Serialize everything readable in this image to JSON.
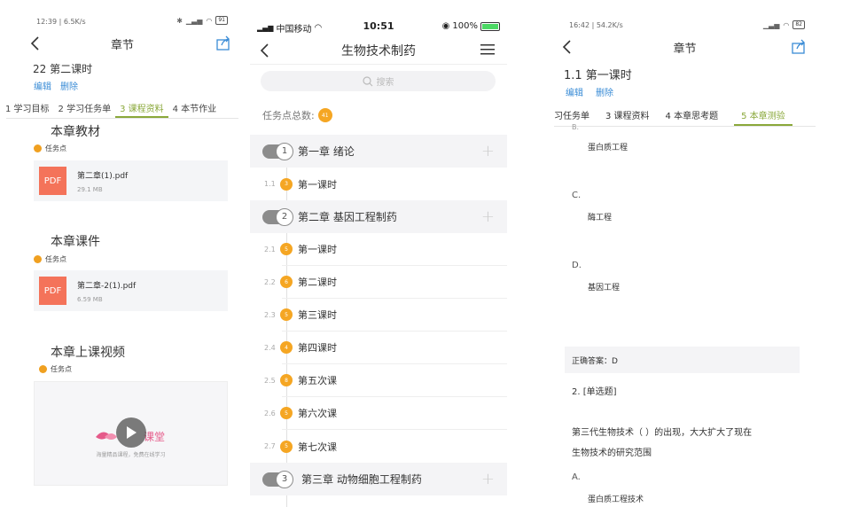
{
  "left": {
    "status_time": "12:39 | 6.5K/s",
    "status_battery": "91",
    "nav_title": "章节",
    "lesson_title": "22 第二课时",
    "edit_label": "编辑",
    "delete_label": "删除",
    "tabs": [
      "1 学习目标",
      "2 学习任务单",
      "3 课程资料",
      "4 本节作业"
    ],
    "active_tab": "3 课程资料",
    "sections": [
      {
        "title": "本章教材",
        "task": "任务点",
        "file_icon": "PDF",
        "file_name": "第二章(1).pdf",
        "file_size": "29.1 MB"
      },
      {
        "title": "本章课件",
        "task": "任务点",
        "file_icon": "PDF",
        "file_name": "第二章-2(1).pdf",
        "file_size": "6.59 MB"
      }
    ],
    "video_section": {
      "title": "本章上课视频",
      "task": "任务点",
      "watermark": "课堂",
      "subtitle": "海量精品课程，免费在线学习"
    }
  },
  "middle": {
    "carrier": "中国移动",
    "clock": "10:51",
    "battery": "100%",
    "nav_title": "生物技术制药",
    "search_placeholder": "搜索",
    "total_label": "任务点总数:",
    "total_count": "41",
    "chapters": [
      {
        "num": "1",
        "title": "第一章 绪论",
        "lessons": [
          {
            "num": "1.1",
            "badge": "3",
            "title": "第一课时"
          }
        ]
      },
      {
        "num": "2",
        "title": "第二章 基因工程制药",
        "lessons": [
          {
            "num": "2.1",
            "badge": "5",
            "title": "第一课时"
          },
          {
            "num": "2.2",
            "badge": "6",
            "title": "第二课时"
          },
          {
            "num": "2.3",
            "badge": "5",
            "title": "第三课时"
          },
          {
            "num": "2.4",
            "badge": "4",
            "title": "第四课时"
          },
          {
            "num": "2.5",
            "badge": "8",
            "title": "第五次课"
          },
          {
            "num": "2.6",
            "badge": "5",
            "title": "第六次课"
          },
          {
            "num": "2.7",
            "badge": "5",
            "title": "第七次课"
          }
        ]
      },
      {
        "num": "3",
        "title": "第三章 动物细胞工程制药",
        "lessons": []
      }
    ]
  },
  "right": {
    "status_time": "16:42 | 54.2K/s",
    "status_battery": "82",
    "nav_title": "章节",
    "lesson_title": "1.1 第一课时",
    "edit_label": "编辑",
    "delete_label": "删除",
    "tabs": [
      "习任务单",
      "3 课程资料",
      "4 本章思考题",
      "5 本章测验"
    ],
    "active_tab": "5 本章测验",
    "q1": {
      "opt_b_letter": "B.",
      "opt_b": "蛋白质工程",
      "opt_c_letter": "C.",
      "opt_c": "酶工程",
      "opt_d_letter": "D.",
      "opt_d": "基因工程",
      "answer": "正确答案：D"
    },
    "q2": {
      "header": "2. [单选题]",
      "text_line1": "第三代生物技术（ ）的出现，大大扩大了现在",
      "text_line2": "生物技术的研究范围",
      "opt_a_letter": "A.",
      "opt_a": "蛋白质工程技术"
    }
  }
}
